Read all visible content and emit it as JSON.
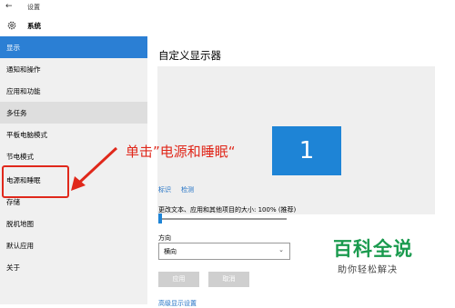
{
  "window": {
    "title": "设置"
  },
  "header": {
    "section": "系统"
  },
  "sidebar": {
    "items": [
      {
        "label": "显示"
      },
      {
        "label": "通知和操作"
      },
      {
        "label": "应用和功能"
      },
      {
        "label": "多任务"
      },
      {
        "label": "平板电脑模式"
      },
      {
        "label": "节电模式"
      },
      {
        "label": "电源和睡眠"
      },
      {
        "label": "存储"
      },
      {
        "label": "脱机地图"
      },
      {
        "label": "默认应用"
      },
      {
        "label": "关于"
      }
    ]
  },
  "main": {
    "title": "自定义显示器",
    "monitor_number": "1",
    "identify_link": "标识",
    "detect_link": "检测",
    "scale_label": "更改文本、应用和其他项目的大小: 100% (推荐)",
    "scale_value": 0,
    "orientation_label": "方向",
    "orientation_value": "横向",
    "apply_button": "应用",
    "cancel_button": "取消",
    "advanced_link": "高级显示设置"
  },
  "annotation": {
    "text": "单击”电源和睡眠“",
    "color": "#e0281b"
  },
  "watermark": {
    "title": "百科全说",
    "subtitle": "助你轻松解决"
  },
  "colors": {
    "accent": "#2b7fd4",
    "monitor": "#1e84d6",
    "annotation": "#e0281b",
    "watermark": "#1a9a4e"
  }
}
